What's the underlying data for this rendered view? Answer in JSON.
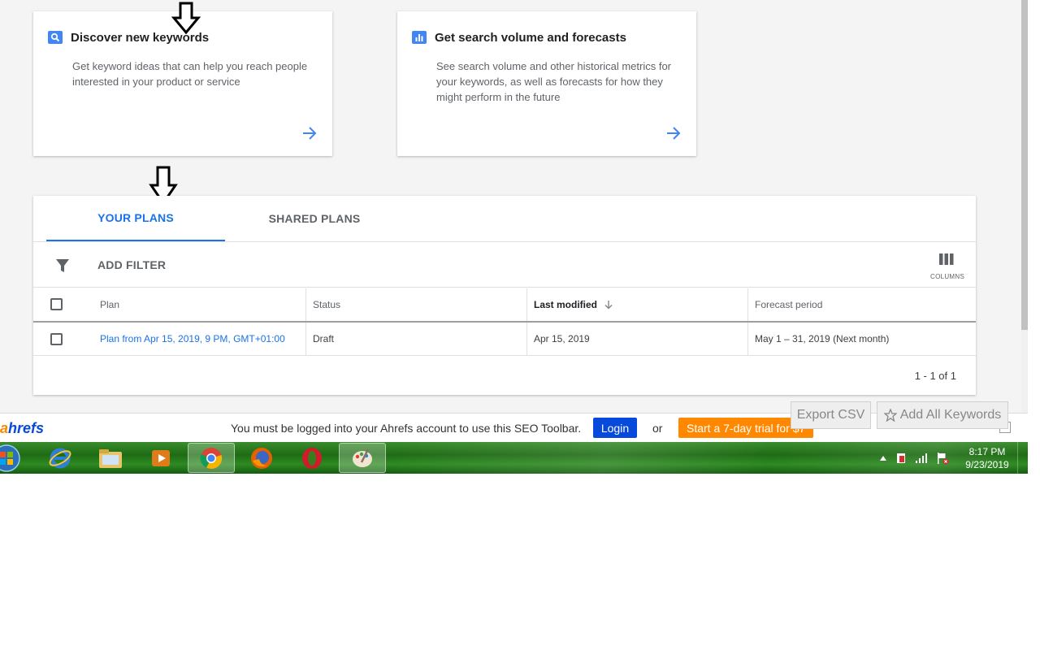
{
  "cards": [
    {
      "title": "Discover new keywords",
      "description": "Get keyword ideas that can help you reach people interested in your product or service"
    },
    {
      "title": "Get search volume and forecasts",
      "description": "See search volume and other historical metrics for your keywords, as well as forecasts for how they might perform in the future"
    }
  ],
  "tabs": {
    "your_plans": "YOUR PLANS",
    "shared_plans": "SHARED PLANS"
  },
  "filter": {
    "label": "ADD FILTER"
  },
  "columns": {
    "label": "COLUMNS"
  },
  "table": {
    "headers": {
      "plan": "Plan",
      "status": "Status",
      "last_modified": "Last modified",
      "forecast_period": "Forecast period"
    },
    "rows": [
      {
        "plan": "Plan from Apr 15, 2019, 9 PM, GMT+01:00",
        "status": "Draft",
        "last_modified": "Apr 15, 2019",
        "forecast_period": "May 1 – 31, 2019 (Next month)"
      }
    ],
    "pagination": "1 - 1 of 1"
  },
  "ahrefs": {
    "logo_a": "a",
    "logo_rest": "hrefs",
    "message": "You must be logged into your Ahrefs account to use this SEO Toolbar.",
    "login": "Login",
    "or": "or",
    "trial": "Start a 7-day trial for $7"
  },
  "extension": {
    "export_csv": "Export CSV",
    "add_all": "Add All Keywords"
  },
  "taskbar": {
    "time": "8:17 PM",
    "date": "9/23/2019"
  },
  "colors": {
    "accent": "#1a73e8",
    "ahrefs_blue": "#054ada",
    "ahrefs_orange": "#ff8800"
  }
}
